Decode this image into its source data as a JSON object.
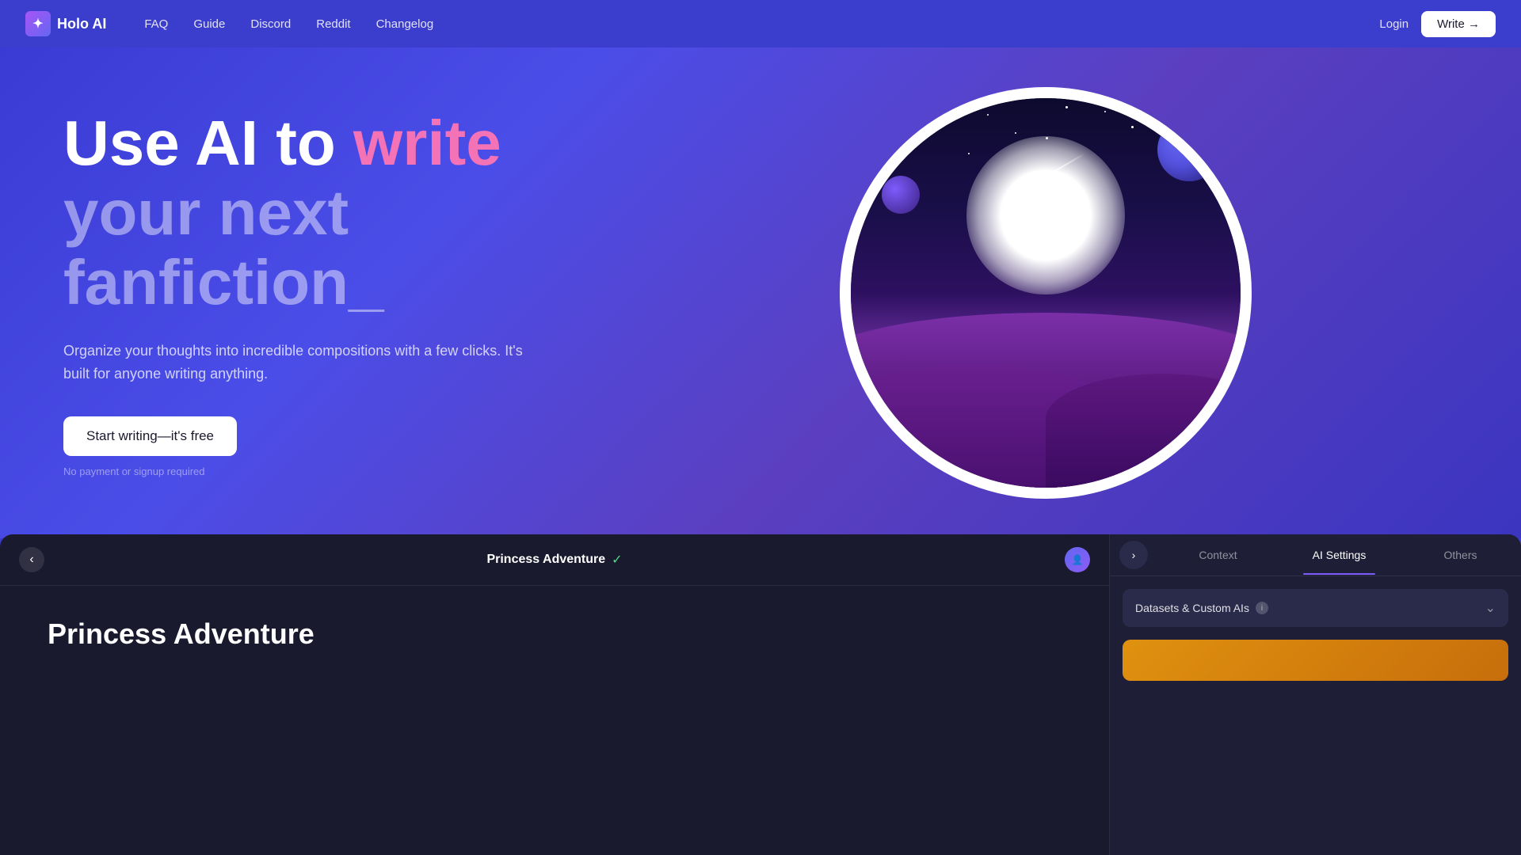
{
  "nav": {
    "logo_text": "Holo AI",
    "links": [
      "FAQ",
      "Guide",
      "Discord",
      "Reddit",
      "Changelog"
    ],
    "login_label": "Login",
    "write_label": "Write →"
  },
  "hero": {
    "title_prefix": "Use AI to ",
    "title_highlight": "write",
    "title_suffix": "your next fanfiction_",
    "description": "Organize your thoughts into incredible compositions with a few clicks. It's built for anyone writing anything.",
    "cta_label": "Start writing—it's free",
    "note": "No payment or signup required"
  },
  "bottom_panel": {
    "back_icon": "‹",
    "title": "Princess Adventure",
    "check_icon": "✓",
    "tabs": [
      "Context",
      "AI Settings",
      "Others"
    ],
    "story_title": "Princess Adventure",
    "datasets_label": "Datasets & Custom AIs",
    "datasets_info": "i",
    "chevron": "⌄",
    "expand_icon": "›"
  }
}
